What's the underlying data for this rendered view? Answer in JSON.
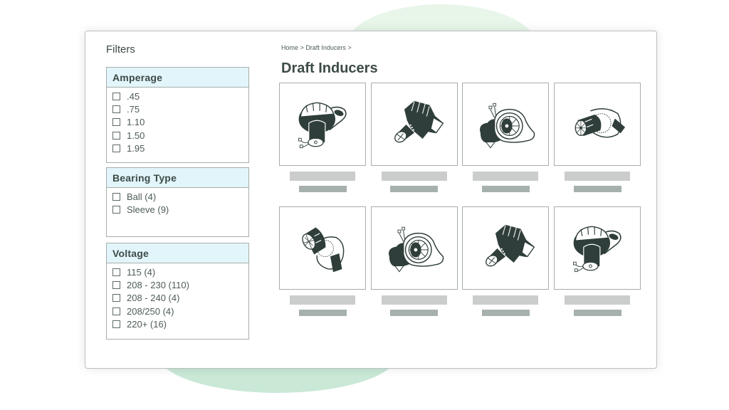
{
  "sidebar": {
    "title": "Filters",
    "groups": [
      {
        "heading": "Amperage",
        "options": [
          ".45",
          ".75",
          "1.10",
          "1.50",
          "1.95"
        ]
      },
      {
        "heading": "Bearing Type",
        "options": [
          "Ball (4)",
          "Sleeve (9)"
        ]
      },
      {
        "heading": "Voltage",
        "options": [
          "115 (4)",
          "208 - 230 (110)",
          "208 - 240 (4)",
          "208/250 (4)",
          "220+ (16)"
        ]
      }
    ]
  },
  "breadcrumb": {
    "items": [
      "Home",
      "Draft Inducers"
    ],
    "separator": ">"
  },
  "page_title": "Draft Inducers",
  "products": [
    {
      "image": "draft-inducer-motor-front-icon",
      "name_placeholder": true,
      "price_placeholder": true
    },
    {
      "image": "draft-inducer-blower-side-icon",
      "name_placeholder": true,
      "price_placeholder": true
    },
    {
      "image": "draft-inducer-wheel-open-icon",
      "name_placeholder": true,
      "price_placeholder": true
    },
    {
      "image": "draft-inducer-motor-angled-icon",
      "name_placeholder": true,
      "price_placeholder": true
    },
    {
      "image": "draft-inducer-motor-tilted-icon",
      "name_placeholder": true,
      "price_placeholder": true
    },
    {
      "image": "draft-inducer-wheel-open-icon",
      "name_placeholder": true,
      "price_placeholder": true
    },
    {
      "image": "draft-inducer-blower-side-icon",
      "name_placeholder": true,
      "price_placeholder": true
    },
    {
      "image": "draft-inducer-motor-front-icon",
      "name_placeholder": true,
      "price_placeholder": true
    }
  ],
  "colors": {
    "accent_header": "#e2f5fb",
    "ink": "#3d4b47",
    "placeholder_light": "#cbcdcc",
    "placeholder_dark": "#a6b1ad",
    "blob_light": "#e8f6ea",
    "blob_dark": "#c9e8d6"
  }
}
